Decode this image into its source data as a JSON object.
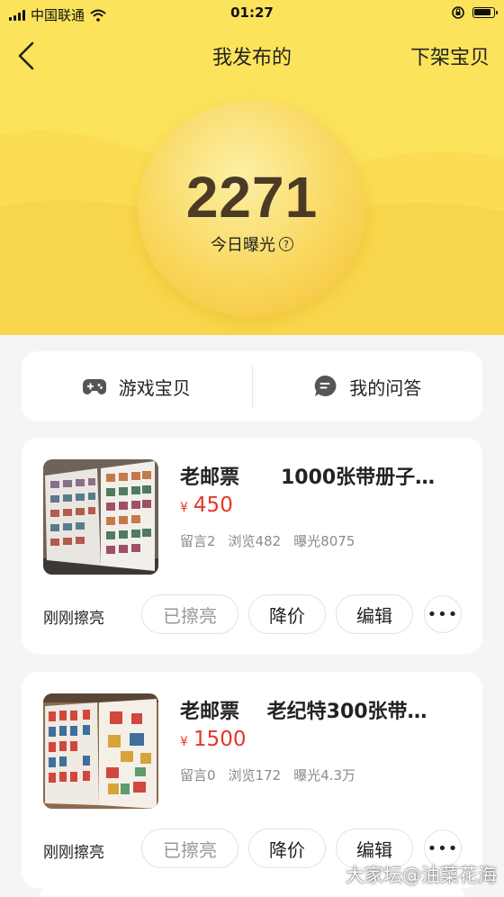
{
  "status_bar": {
    "carrier": "中国联通",
    "time": "01:27"
  },
  "nav": {
    "title": "我发布的",
    "action_label": "下架宝贝"
  },
  "exposure": {
    "count": "2271",
    "label": "今日曝光",
    "help_symbol": "?"
  },
  "tabs": [
    {
      "label": "游戏宝贝",
      "icon": "gamepad-icon"
    },
    {
      "label": "我的问答",
      "icon": "chat-bubble-icon"
    }
  ],
  "items": [
    {
      "title": "老邮票      1000张带册子…",
      "currency": "¥",
      "price": "450",
      "stats": {
        "comments": "留言2",
        "views": "浏览482",
        "exposure": "曝光8075"
      },
      "refresh_time": "刚刚擦亮",
      "buttons": {
        "polished": "已擦亮",
        "reduce_price": "降价",
        "edit": "编辑",
        "more": "•••"
      }
    },
    {
      "title": "老邮票    老纪特300张带…",
      "currency": "¥",
      "price": "1500",
      "stats": {
        "comments": "留言0",
        "views": "浏览172",
        "exposure": "曝光4.3万"
      },
      "refresh_time": "刚刚擦亮",
      "buttons": {
        "polished": "已擦亮",
        "reduce_price": "降价",
        "edit": "编辑",
        "more": "•••"
      }
    }
  ],
  "watermark": "大家坛@油菜花海",
  "colors": {
    "hero_yellow": "#fbe35c",
    "price_red": "#e8352a",
    "background": "#f5f5f5"
  }
}
